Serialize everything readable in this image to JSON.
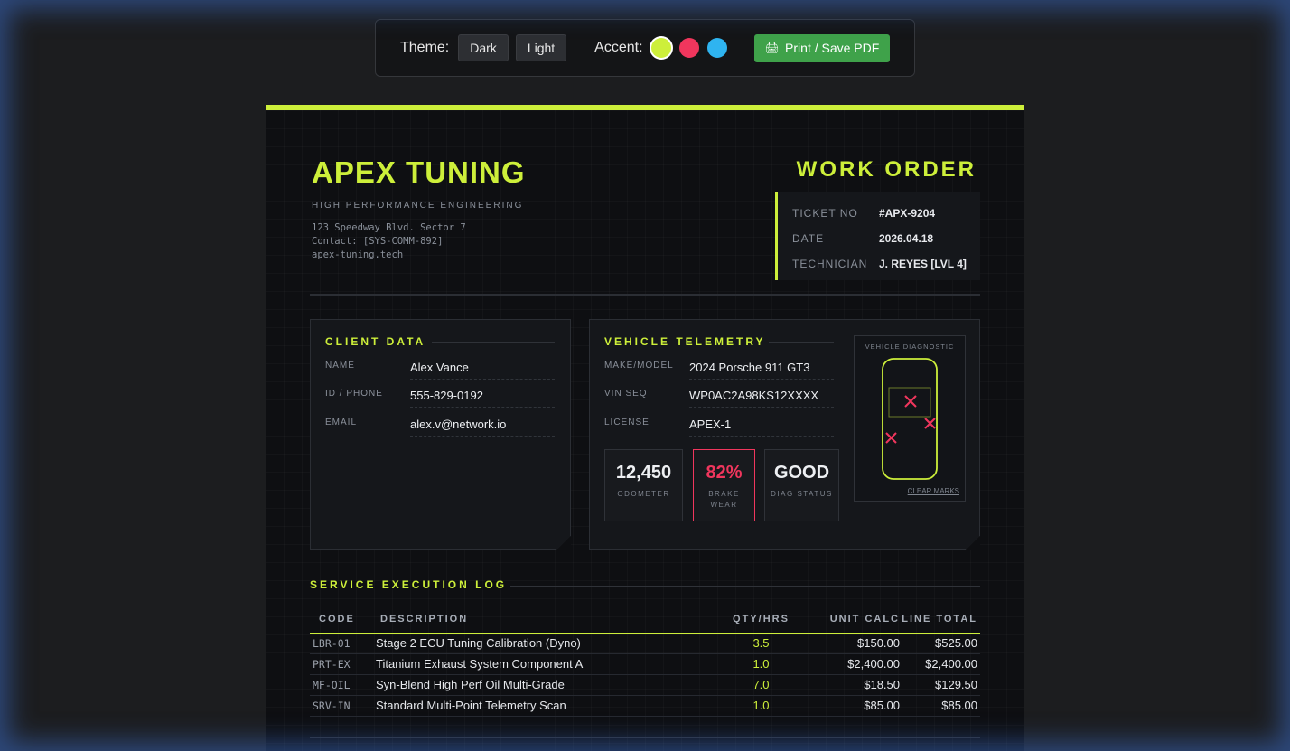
{
  "toolbar": {
    "theme_label": "Theme:",
    "dark_label": "Dark",
    "light_label": "Light",
    "accent_label": "Accent:",
    "accents": [
      "#cdef3a",
      "#f0365d",
      "#2fb4f0"
    ],
    "print_label": "Print / Save PDF"
  },
  "header": {
    "brand": "APEX TUNING",
    "tagline": "HIGH PERFORMANCE ENGINEERING",
    "address": "123 Speedway Blvd. Sector 7",
    "contact": "Contact: [SYS-COMM-892]",
    "website": "apex-tuning.tech",
    "doc_title": "WORK ORDER"
  },
  "meta": {
    "ticket_label": "TICKET NO",
    "ticket": "#APX-9204",
    "date_label": "DATE",
    "date": "2026.04.18",
    "tech_label": "TECHNICIAN",
    "tech": "J. REYES [LVL 4]"
  },
  "client": {
    "title": "CLIENT DATA",
    "name_label": "NAME",
    "name": "Alex Vance",
    "phone_label": "ID / PHONE",
    "phone": "555-829-0192",
    "email_label": "EMAIL",
    "email": "alex.v@network.io"
  },
  "vehicle": {
    "title": "VEHICLE TELEMETRY",
    "model_label": "MAKE/MODEL",
    "model": "2024 Porsche 911 GT3",
    "vin_label": "VIN SEQ",
    "vin": "WP0AC2A98KS12XXXX",
    "license_label": "LICENSE",
    "license": "APEX-1",
    "odometer": "12,450",
    "odometer_label": "ODOMETER",
    "brake": "82%",
    "brake_label": "BRAKE WEAR",
    "diag": "GOOD",
    "diag_label": "DIAG STATUS",
    "diagram_title": "VEHICLE DIAGNOSTIC",
    "clear_label": "CLEAR MARKS"
  },
  "log": {
    "title": "SERVICE EXECUTION LOG",
    "headers": {
      "code": "CODE",
      "desc": "DESCRIPTION",
      "qty": "QTY/HRS",
      "unit": "UNIT CALC",
      "total": "LINE TOTAL"
    },
    "rows": [
      {
        "code": "LBR-01",
        "desc": "Stage 2 ECU Tuning Calibration (Dyno)",
        "qty": "3.5",
        "unit": "$150.00",
        "total": "$525.00"
      },
      {
        "code": "PRT-EX",
        "desc": "Titanium Exhaust System Component A",
        "qty": "1.0",
        "unit": "$2,400.00",
        "total": "$2,400.00"
      },
      {
        "code": "MF-OIL",
        "desc": "Syn-Blend High Perf Oil Multi-Grade",
        "qty": "7.0",
        "unit": "$18.50",
        "total": "$129.50"
      },
      {
        "code": "SRV-IN",
        "desc": "Standard Multi-Point Telemetry Scan",
        "qty": "1.0",
        "unit": "$85.00",
        "total": "$85.00"
      }
    ]
  }
}
